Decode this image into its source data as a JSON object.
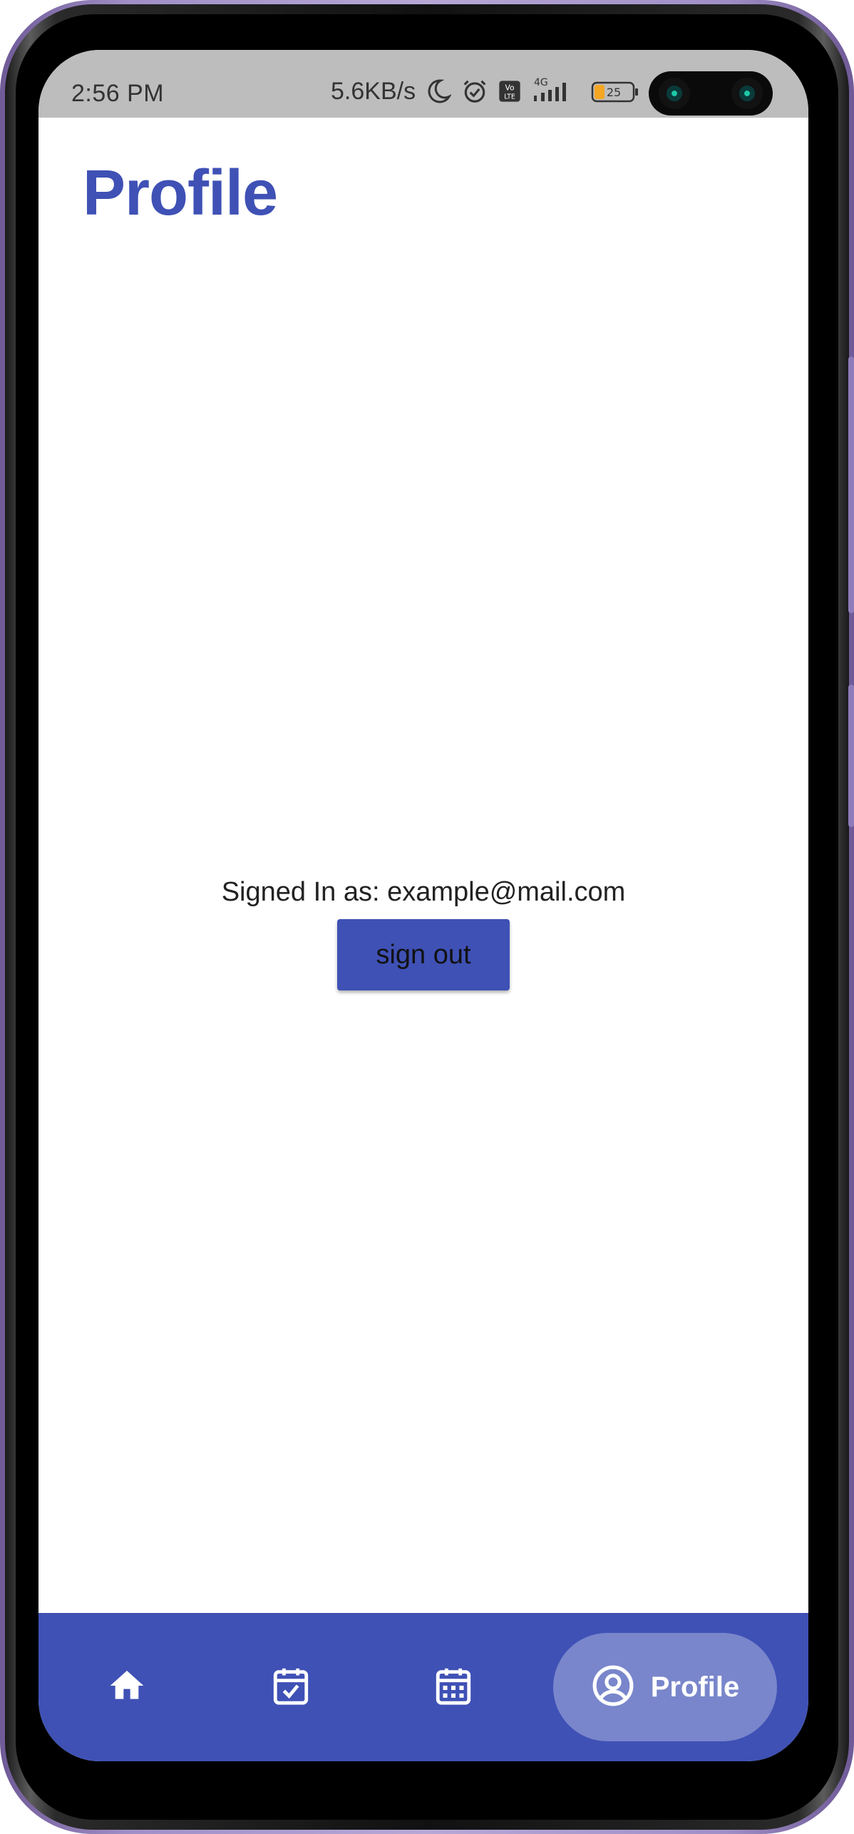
{
  "status_bar": {
    "time": "2:56 PM",
    "net_speed": "5.6KB/s",
    "network": "4G",
    "volte": "Vo LTE",
    "battery": "25"
  },
  "page": {
    "title": "Profile",
    "signed_in_text": "Signed In as: example@mail.com",
    "sign_out_label": "sign out"
  },
  "bottom_nav": {
    "items": [
      {
        "name": "home",
        "icon": "home-icon"
      },
      {
        "name": "tasks",
        "icon": "calendar-check-icon"
      },
      {
        "name": "calendar",
        "icon": "calendar-icon"
      },
      {
        "name": "profile",
        "icon": "account-circle-icon",
        "label": "Profile",
        "active": true
      }
    ]
  },
  "colors": {
    "primary": "#3f51b5",
    "active_pill": "#7986cb",
    "status_bar": "#bdbdbd"
  }
}
